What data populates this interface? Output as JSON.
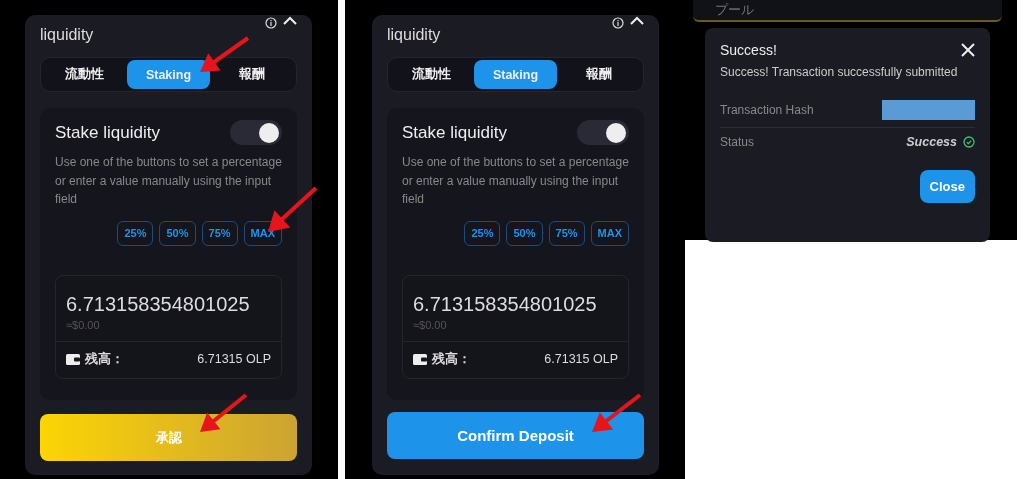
{
  "panels": [
    {
      "title": "liquidity",
      "tabs": [
        {
          "label": "流動性",
          "selected": false
        },
        {
          "label": "Staking",
          "selected": true
        },
        {
          "label": "報酬",
          "selected": false
        }
      ],
      "section_title": "Stake liquidity",
      "toggle_on": true,
      "description": "Use one of the buttons to set a percentage or enter a value manually using the input field",
      "percent_buttons": [
        "25%",
        "50%",
        "75%",
        "MAX"
      ],
      "amount": "6.713158354801025",
      "usd_value": "≈$0.00",
      "balance_label": "残高：",
      "balance": "6.71315 OLP",
      "action_button": {
        "label": "承認",
        "kind": "gold"
      }
    },
    {
      "title": "liquidity",
      "tabs": [
        {
          "label": "流動性",
          "selected": false
        },
        {
          "label": "Staking",
          "selected": true
        },
        {
          "label": "報酬",
          "selected": false
        }
      ],
      "section_title": "Stake liquidity",
      "toggle_on": true,
      "description": "Use one of the buttons to set a percentage or enter a value manually using the input field",
      "percent_buttons": [
        "25%",
        "50%",
        "75%",
        "MAX"
      ],
      "amount": "6.713158354801025",
      "usd_value": "≈$0.00",
      "balance_label": "残高：",
      "balance": "6.71315 OLP",
      "action_button": {
        "label": "Confirm Deposit",
        "kind": "blue"
      }
    }
  ],
  "background_card": {
    "label": "プール"
  },
  "success_dialog": {
    "title": "Success!",
    "message": "Success! Transaction successfully submitted",
    "rows": [
      {
        "label": "Transaction Hash",
        "kind": "redacted"
      },
      {
        "label": "Status",
        "kind": "status",
        "value": "Success"
      }
    ],
    "close_button": "Close"
  }
}
